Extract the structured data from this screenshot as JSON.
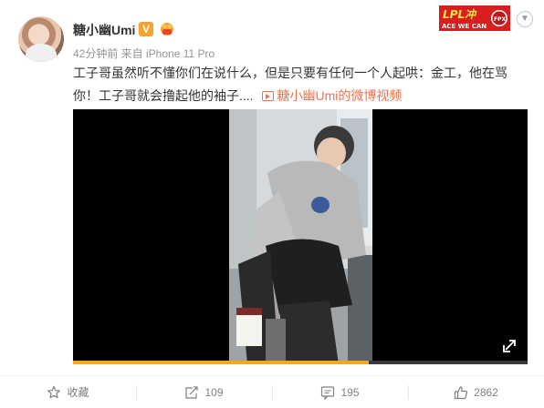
{
  "post": {
    "username": "糖小幽Umi",
    "verified_badge": "V",
    "meta": "42分钟前 来自 iPhone 11 Pro",
    "text_main": "工子哥虽然听不懂你们在说什么，但是只要有任何一个人起哄：金工，他在骂你！工子哥就会撸起他的袖子....",
    "video_link": "糖小幽Umi的微博视频",
    "accent_color": "#eb7350",
    "icons": [
      "avatar",
      "verified-icon",
      "fan-badge-icon",
      "chevron-down-icon",
      "video-icon",
      "fullscreen-icon",
      "collect-icon",
      "repost-icon",
      "comment-icon",
      "like-icon"
    ]
  },
  "banner": {
    "top_text": "LPL冲",
    "bottom_text": "ACE WE CAN",
    "logo_text": "FPX"
  },
  "video": {
    "progress": 0.65
  },
  "actions": {
    "collect": "收藏",
    "repost": "109",
    "comment": "195",
    "like": "2862"
  }
}
